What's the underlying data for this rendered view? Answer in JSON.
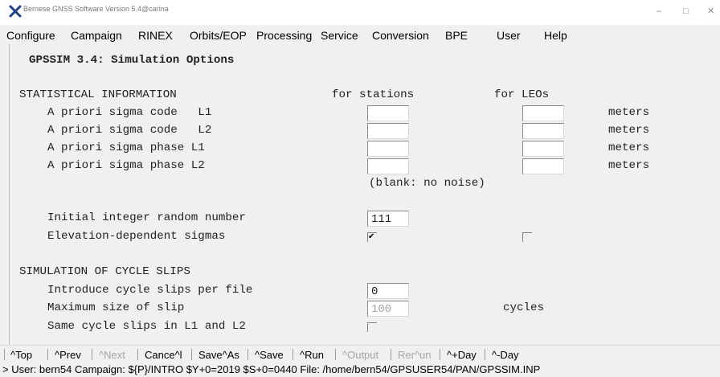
{
  "window": {
    "title": "Bernese GNSS Software Version 5.4@carina",
    "controls": {
      "minimize": "–",
      "maximize": "□",
      "close": "✕"
    }
  },
  "menubar": [
    "Configure",
    "Campaign",
    "RINEX",
    "Orbits/EOP",
    "Processing",
    "Service",
    "Conversion",
    "BPE",
    "User",
    "Help"
  ],
  "panel": {
    "heading": "GPSSIM 3.4: Simulation Options",
    "statistical": {
      "title": "STATISTICAL INFORMATION",
      "col_stations": "for stations",
      "col_leos": "for LEOs",
      "rows": [
        {
          "label": "A priori sigma code   L1",
          "station": "",
          "leo": "",
          "unit": "meters"
        },
        {
          "label": "A priori sigma code   L2",
          "station": "",
          "leo": "",
          "unit": "meters"
        },
        {
          "label": "A priori sigma phase L1",
          "station": "",
          "leo": "",
          "unit": "meters"
        },
        {
          "label": "A priori sigma phase L2",
          "station": "",
          "leo": "",
          "unit": "meters"
        }
      ],
      "note": "(blank: no noise)"
    },
    "random": {
      "label": "Initial integer random number",
      "value": "111"
    },
    "elevation": {
      "label": "Elevation-dependent sigmas",
      "stations_checked": true,
      "leos_checked": false
    },
    "cycle_slips": {
      "title": "SIMULATION OF CYCLE SLIPS",
      "introduce": {
        "label": "Introduce cycle slips per file",
        "value": "0"
      },
      "max_size": {
        "label": "Maximum size of slip",
        "value": "100",
        "unit": "cycles"
      },
      "same_slips": {
        "label": "Same cycle slips in L1 and L2",
        "checked": false
      }
    }
  },
  "toolbar": {
    "buttons": [
      {
        "label": "^Top",
        "enabled": true
      },
      {
        "label": "^Prev",
        "enabled": true
      },
      {
        "label": "^Next",
        "enabled": false
      },
      {
        "label": "Cance^l",
        "enabled": true
      },
      {
        "label": "Save^As",
        "enabled": true
      },
      {
        "label": "^Save",
        "enabled": true
      },
      {
        "label": "^Run",
        "enabled": true
      },
      {
        "label": "^Output",
        "enabled": false
      },
      {
        "label": "Rer^un",
        "enabled": false
      },
      {
        "label": "^+Day",
        "enabled": true
      },
      {
        "label": "^-Day",
        "enabled": true
      }
    ]
  },
  "status": "> User: bern54  Campaign: ${P}/INTRO  $Y+0=2019  $S+0=0440  File: /home/bern54/GPSUSER54/PAN/GPSSIM.INP"
}
